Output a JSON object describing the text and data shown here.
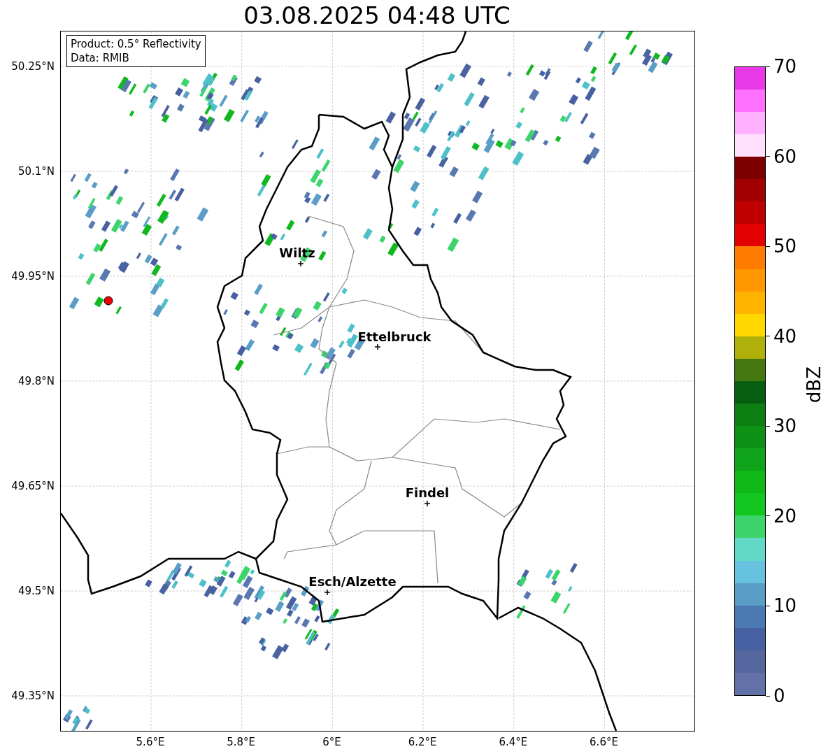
{
  "title": "03.08.2025 04:48 UTC",
  "info_box": {
    "lines": [
      "Product: 0.5° Reflectivity",
      "Data: RMIB"
    ]
  },
  "cities": [
    {
      "name": "Wiltz"
    },
    {
      "name": "Ettelbruck"
    },
    {
      "name": "Findel"
    },
    {
      "name": "Esch/Alzette"
    }
  ],
  "y_axis": {
    "ticks": [
      "50.25°N",
      "50.1°N",
      "49.95°N",
      "49.8°N",
      "49.65°N",
      "49.5°N",
      "49.35°N"
    ]
  },
  "x_axis": {
    "ticks": [
      "5.6°E",
      "5.8°E",
      "6°E",
      "6.2°E",
      "6.4°E",
      "6.6°E"
    ]
  },
  "colorbar": {
    "label": "dBZ",
    "ticks": [
      "70",
      "60",
      "50",
      "40",
      "30",
      "20",
      "10",
      "0"
    ]
  }
}
